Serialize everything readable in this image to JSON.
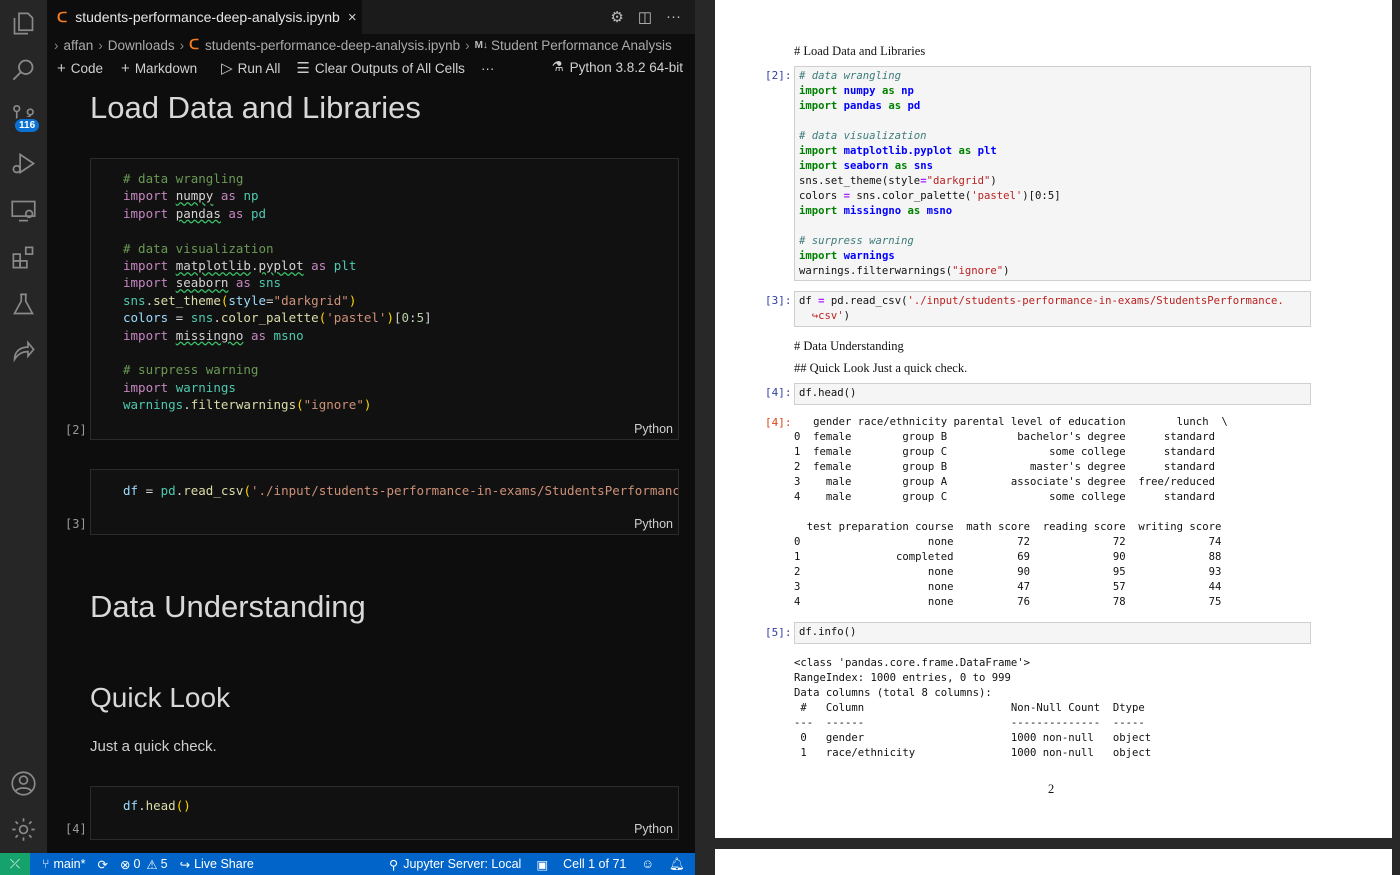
{
  "tab": {
    "title": "students-performance-deep-analysis.ipynb",
    "close": "×"
  },
  "breadcrumb": {
    "user": "affan",
    "folder": "Downloads",
    "file": "students-performance-deep-analysis.ipynb",
    "md_badge": "M↓",
    "section": "Student Performance Analysis"
  },
  "toolbar": {
    "code": "Code",
    "markdown": "Markdown",
    "run_all": "Run All",
    "clear": "Clear Outputs of All Cells",
    "more": "···",
    "kernel": "Python 3.8.2 64-bit"
  },
  "activity": {
    "scm_badge": "116"
  },
  "notebook": {
    "h_load": "Load Data and Libraries",
    "h_understanding": "Data Understanding",
    "h_quicklook": "Quick Look",
    "p_quick": "Just a quick check.",
    "cell2_num": "[2]",
    "cell3_num": "[3]",
    "cell4_num": "[4]",
    "lang": "Python"
  },
  "status": {
    "branch": "main*",
    "errors": "0",
    "warnings": "5",
    "live_share": "Live Share",
    "jupyter": "Jupyter Server: Local",
    "cell_pos": "Cell 1 of 71"
  },
  "pdf": {
    "h_load": "# Load Data and Libraries",
    "n2": "[2]:",
    "n3": "[3]:",
    "h_understanding": "# Data Understanding",
    "h_quicklook": "## Quick Look Just a quick check.",
    "n4": "[4]:",
    "n4out": "[4]:",
    "head_code": "df.head()",
    "n5": "[5]:",
    "info_code": "df.info()",
    "head_out": "   gender race/ethnicity parental level of education        lunch  \\\n0  female        group B           bachelor's degree      standard\n1  female        group C                some college      standard\n2  female        group B             master's degree      standard\n3    male        group A          associate's degree  free/reduced\n4    male        group C                some college      standard\n\n  test preparation course  math score  reading score  writing score\n0                    none          72             72             74\n1               completed          69             90             88\n2                    none          90             95             93\n3                    none          47             57             44\n4                    none          76             78             75",
    "info_out": "<class 'pandas.core.frame.DataFrame'>\nRangeIndex: 1000 entries, 0 to 999\nData columns (total 8 columns):\n #   Column                       Non-Null Count  Dtype\n---  ------                       --------------  -----\n 0   gender                       1000 non-null   object\n 1   race/ethnicity               1000 non-null   object",
    "page_number": "2"
  },
  "colors": {
    "accent": "#0064c8",
    "remote": "#15a36b",
    "notebook_icon": "#f57c1f"
  }
}
